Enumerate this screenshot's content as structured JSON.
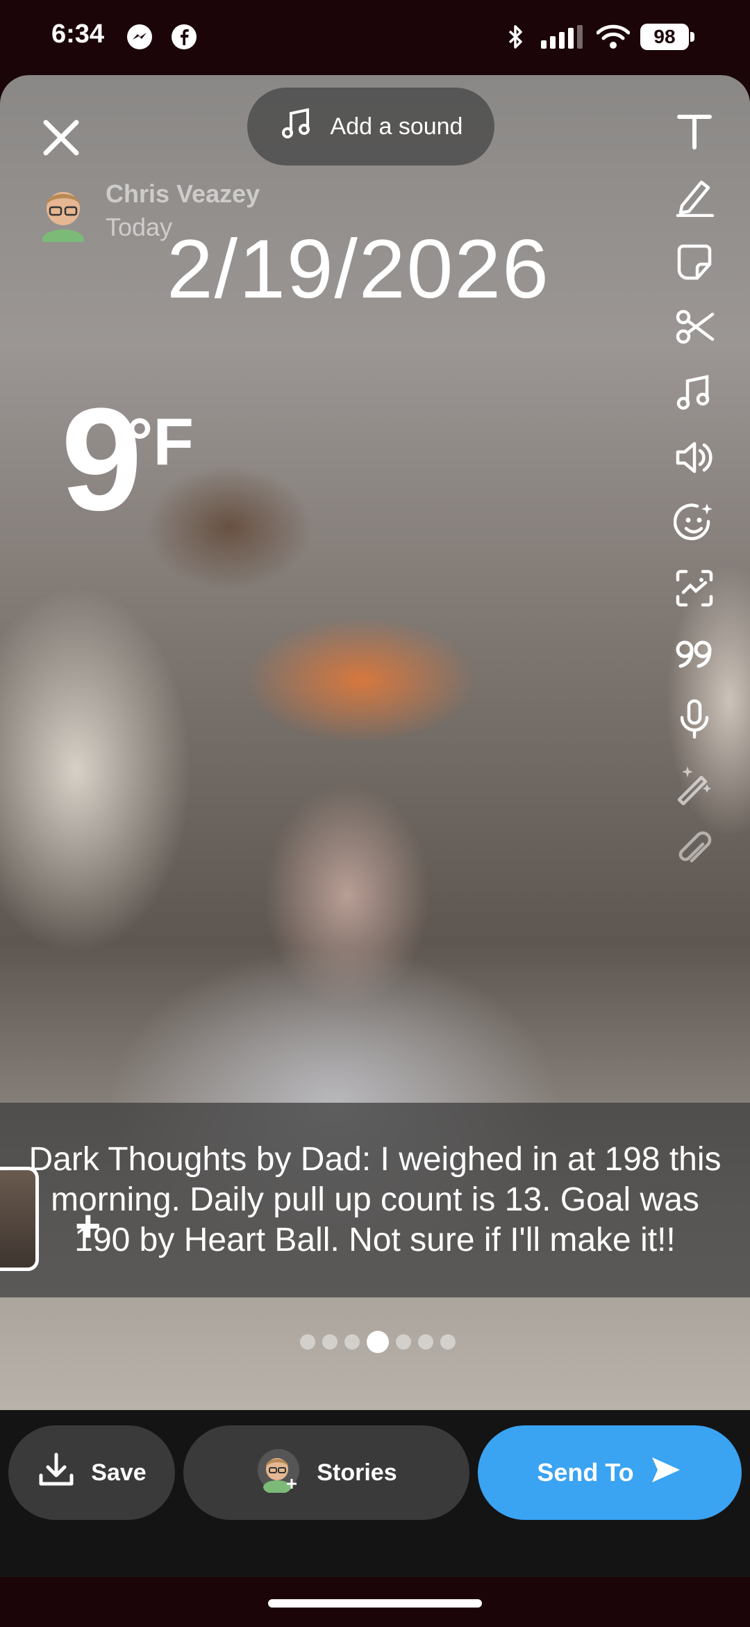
{
  "status_bar": {
    "time": "6:34",
    "battery": "98",
    "icons": [
      "messenger-icon",
      "facebook-icon",
      "bluetooth-icon",
      "signal-icon",
      "wifi-icon"
    ]
  },
  "snap": {
    "add_sound_label": "Add a sound",
    "poster_name": "Chris Veazey",
    "poster_time": "Today",
    "date_sticker": "2/19/2026",
    "temperature_value": "9",
    "temperature_unit": "°F",
    "caption": "Dark Thoughts by Dad: I weighed in at 198 this morning.  Daily pull up count is 13. Goal was 190 by Heart Ball.  Not sure if I'll make it!!",
    "page_dots": {
      "count": 7,
      "active_index": 3
    },
    "tools": [
      "text-icon",
      "pencil-icon",
      "sticker-icon",
      "scissors-icon",
      "music-icon",
      "speaker-icon",
      "smiley-sparkle-icon",
      "scan-icon",
      "quote-icon",
      "microphone-icon",
      "magic-wand-icon",
      "paperclip-icon"
    ]
  },
  "bottom": {
    "save_label": "Save",
    "stories_label": "Stories",
    "send_label": "Send To"
  },
  "colors": {
    "send_button": "#3aa3f2",
    "status_bar_bg": "#1c0509",
    "bottom_bar_bg": "#141414",
    "pill_bg": "#3a3a3a"
  }
}
